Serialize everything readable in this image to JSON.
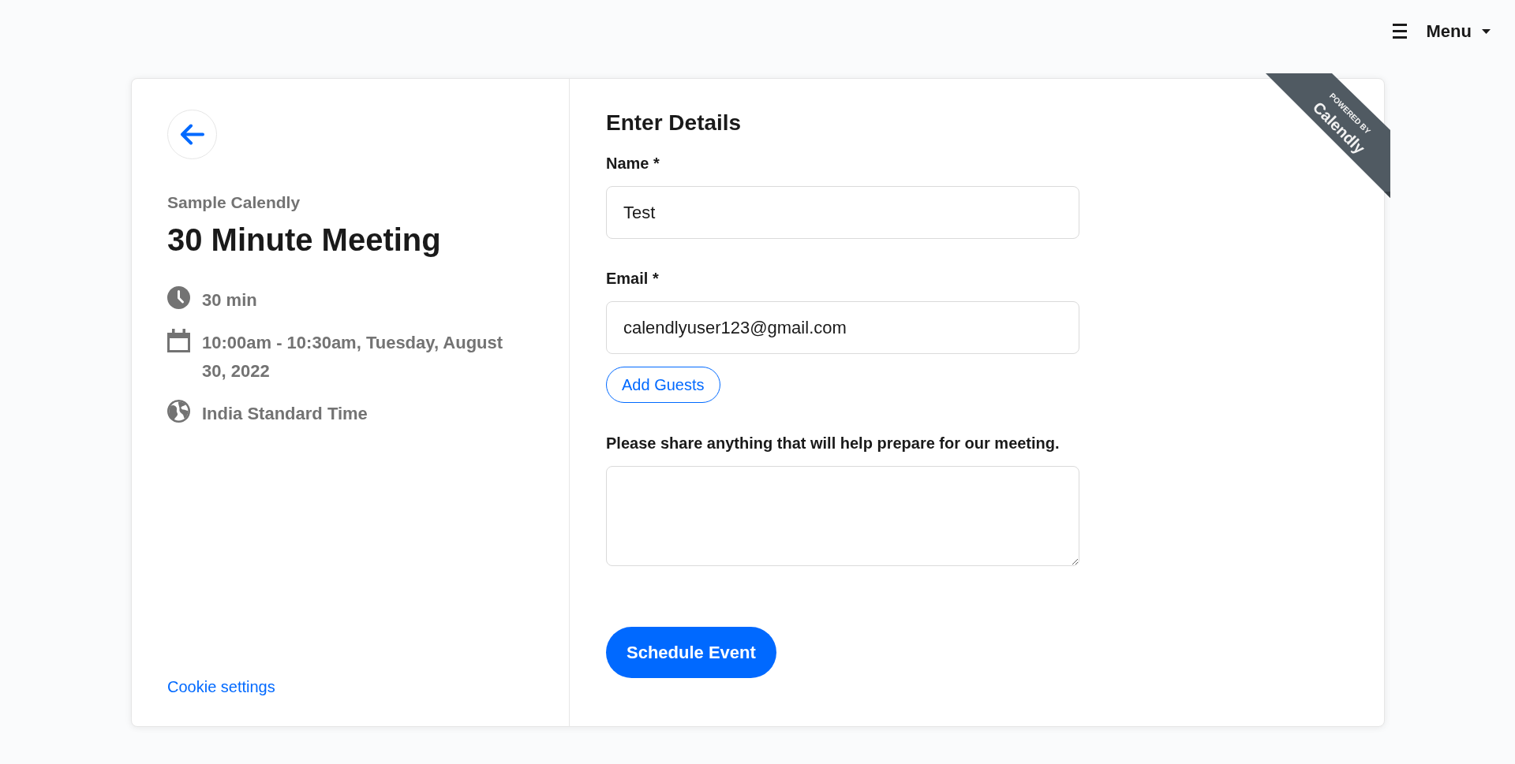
{
  "header": {
    "menu_label": "Menu"
  },
  "event": {
    "organizer": "Sample Calendly",
    "title": "30 Minute Meeting",
    "details": [
      {
        "kind": "duration",
        "text": "30 min"
      },
      {
        "kind": "date_time",
        "text": "10:00am - 10:30am, Tuesday, August 30, 2022"
      },
      {
        "kind": "time_zone",
        "text": "India Standard Time"
      }
    ],
    "cookie_link": "Cookie settings"
  },
  "form": {
    "title": "Enter Details",
    "items": [
      {
        "kind": "input",
        "label": "Name *",
        "value": "Test"
      },
      {
        "kind": "input",
        "label": "Email *",
        "value": "calendlyuser123@gmail.com"
      },
      {
        "kind": "outline_button",
        "text": "Add Guests"
      },
      {
        "kind": "textarea",
        "label": "Please share anything that will help prepare for our meeting."
      }
    ],
    "submit": "Schedule Event"
  },
  "ribbon": {
    "line_1": "POWERED BY",
    "line_2": "Calendly"
  }
}
